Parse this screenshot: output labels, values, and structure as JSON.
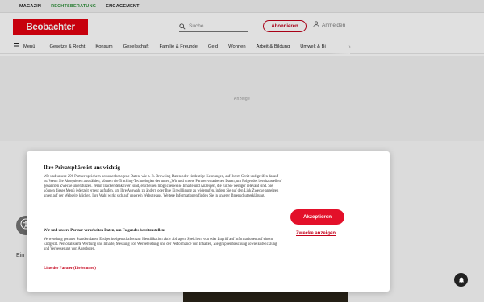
{
  "topbar": {
    "links": [
      "MAGAZIN",
      "RECHTSBERATUNG",
      "ENGAGEMENT"
    ]
  },
  "header": {
    "logo": "Beobachter",
    "search_placeholder": "Suche",
    "subscribe_label": "Abonnieren",
    "login_label": "Anmelden"
  },
  "nav": {
    "menu_label": "Menü",
    "items": [
      "Gesetze & Recht",
      "Konsum",
      "Gesellschaft",
      "Familie & Freunde",
      "Geld",
      "Wohnen",
      "Arbeit & Bildung",
      "Umwelt & Bi"
    ]
  },
  "ad": {
    "label": "Anzeige"
  },
  "article": {
    "partial_text": "Ein"
  },
  "consent": {
    "title": "Ihre Privatsphäre ist uns wichtig",
    "body": "Wir und unsere 296 Partner speichern personenbezogene Daten, wie z. B. Browsing-Daten oder eindeutige Kennungen, auf Ihrem Gerät und greifen darauf zu. Wenn Sie Akzeptieren auswählen, können die Tracking-Technologien der unter „Wir und unsere Partner verarbeiten Daten, um Folgendes bereitzustellen“ genannten Zwecke unterstützen. Wenn Tracker deaktiviert sind, erscheinen möglicherweise Inhalte und Anzeigen, die für Sie weniger relevant sind. Sie können dieses Menü jederzeit erneut aufrufen, um Ihre Auswahl zu ändern oder Ihre Einwilligung zu widerrufen, indem Sie auf den Link Zwecke anzeigen unten auf der Webseite klicken. Ihre Wahl wirkt sich auf unsere/n Website aus. Weitere Informationen finden Sie in unserer Datenschutzerklärung.",
    "subtitle": "Wir und unsere Partner verarbeiten Daten, um Folgendes bereitzustellen:",
    "body2": "Verwendung genauer Standortdaten. Endgerätseigenschaften zur Identifikation aktiv abfragen. Speichern von oder Zugriff auf Informationen auf einem Endgerät. Personalisierte Werbung und Inhalte, Messung von Werbeleistung und der Performance von Inhalten, Zielgruppenforschung sowie Entwicklung und Verbesserung von Angeboten.",
    "partners_link": "Liste der Partner (Lieferanten)",
    "accept_label": "Akzeptieren",
    "purposes_label": "Zwecke anzeigen"
  },
  "colors": {
    "brand_red": "#e3000f",
    "link_red": "#c4001a",
    "green": "#2f8f3a"
  }
}
